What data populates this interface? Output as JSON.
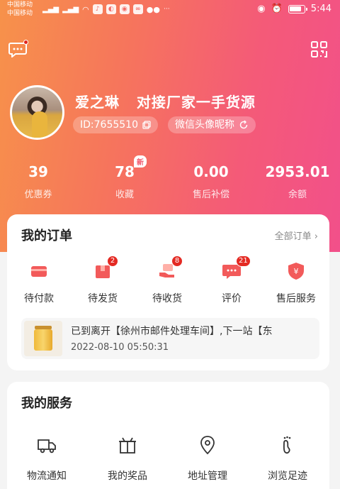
{
  "status_bar": {
    "carrier1": "中国移动",
    "carrier2": "中国移动",
    "time": "5:44"
  },
  "profile": {
    "name": "爱之琳   对接厂家一手货源",
    "id_label": "ID:7655510",
    "wechat_sync": "微信头像昵称"
  },
  "stats": [
    {
      "value": "39",
      "label": "优惠券"
    },
    {
      "value": "78",
      "label": "收藏",
      "badge": "新"
    },
    {
      "value": "0.00",
      "label": "售后补偿"
    },
    {
      "value": "2953.01",
      "label": "余额"
    }
  ],
  "orders": {
    "title": "我的订单",
    "all_link": "全部订单",
    "items": [
      {
        "label": "待付款",
        "count": null,
        "icon": "wallet-icon"
      },
      {
        "label": "待发货",
        "count": "2",
        "icon": "package-icon"
      },
      {
        "label": "待收货",
        "count": "8",
        "icon": "receive-hand-icon"
      },
      {
        "label": "评价",
        "count": "21",
        "icon": "comment-icon"
      },
      {
        "label": "售后服务",
        "count": null,
        "icon": "shield-yen-icon"
      }
    ],
    "logistics": {
      "text": "已到离开【徐州市邮件处理车间】,下一站【东",
      "time": "2022-08-10 05:50:31"
    }
  },
  "services": {
    "title": "我的服务",
    "items": [
      {
        "label": "物流通知",
        "icon": "truck-icon"
      },
      {
        "label": "我的奖品",
        "icon": "gift-icon"
      },
      {
        "label": "地址管理",
        "icon": "location-pin-icon"
      },
      {
        "label": "浏览足迹",
        "icon": "footprint-icon"
      }
    ]
  },
  "colors": {
    "gradient_start": "#f7924a",
    "gradient_end": "#f2508a",
    "accent_red": "#e42a23"
  }
}
